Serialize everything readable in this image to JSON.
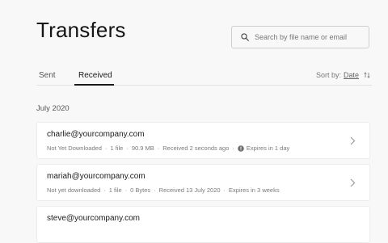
{
  "page": {
    "title": "Transfers"
  },
  "search": {
    "placeholder": "Search by file name or email"
  },
  "tabs": [
    {
      "label": "Sent"
    },
    {
      "label": "Received"
    }
  ],
  "active_tab": "Received",
  "sort": {
    "label": "Sort by:",
    "value": "Date"
  },
  "groups": [
    {
      "heading": "July 2020",
      "transfers": [
        {
          "email": "charlie@yourcompany.com",
          "status": "Not Yet Downloaded",
          "files": "1 file",
          "size": "90.9 MB",
          "received": "Received 2 seconds ago",
          "expires": "Expires in 1 day",
          "expires_warning": true
        },
        {
          "email": "mariah@yourcompany.com",
          "status": "Not yet downloaded",
          "files": "1 file",
          "size": "0 Bytes",
          "received": "Received 13 July 2020",
          "expires": "Expires in 3 weeks",
          "expires_warning": false
        },
        {
          "email": "steve@yourcompany.com"
        }
      ]
    }
  ],
  "colors": {
    "background": "#f8f8f8",
    "card": "#ffffff",
    "text": "#1e1e1e",
    "muted": "#7a7a7a"
  },
  "icons": {
    "search": "search-icon",
    "sort": "sort-arrows-icon",
    "warning": "info-circle-icon",
    "chevron": "chevron-right-icon"
  }
}
